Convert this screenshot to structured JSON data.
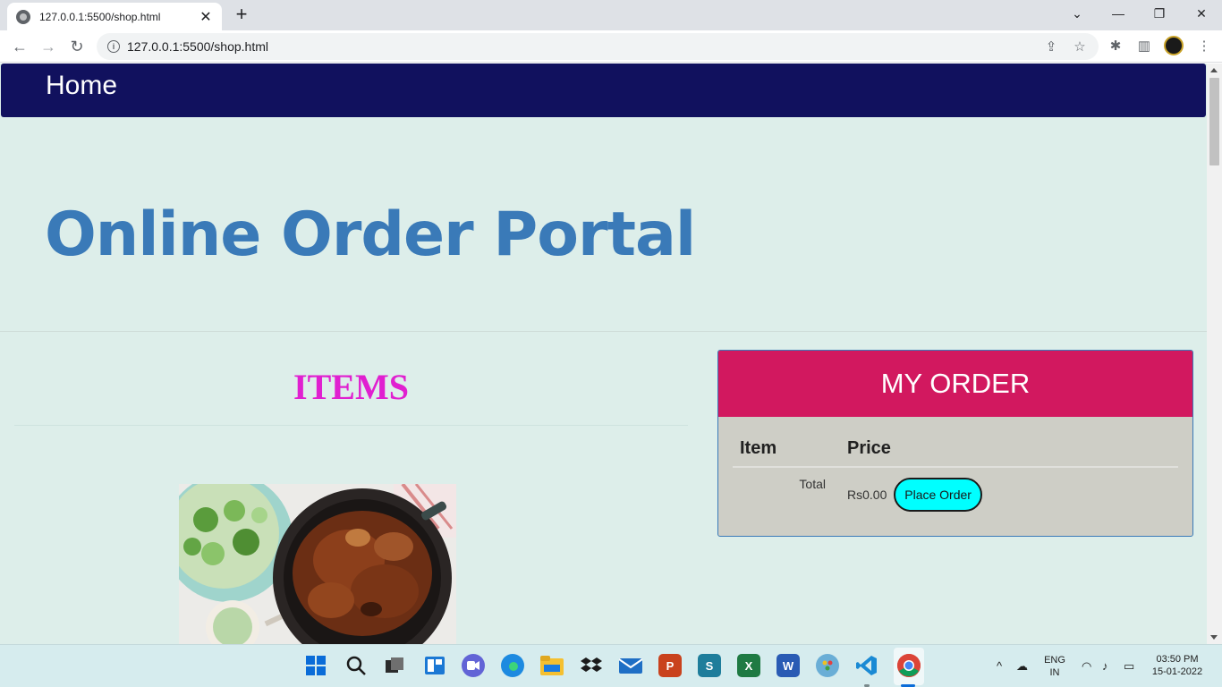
{
  "browser": {
    "tab_title": "127.0.0.1:5500/shop.html",
    "tab_close": "✕",
    "new_tab": "+",
    "url": "127.0.0.1:5500/shop.html",
    "win_controls": {
      "dropdown": "⌄",
      "minimize": "—",
      "restore": "❐",
      "close": "✕"
    },
    "nav": {
      "back": "←",
      "forward": "→",
      "reload": "↻"
    },
    "icons": {
      "share": "⇪",
      "star": "☆",
      "extensions": "✱",
      "sidepanel": "▥",
      "menu": "⋮"
    }
  },
  "site": {
    "nav_home": "Home",
    "hero_title": "Online Order Portal",
    "items_heading": "ITEMS",
    "order": {
      "title": "MY ORDER",
      "col_item": "Item",
      "col_price": "Price",
      "total_label": "Total",
      "total_value": "Rs0.00",
      "place_order": "Place Order"
    }
  },
  "taskbar": {
    "lang_top": "ENG",
    "lang_bottom": "IN",
    "time": "03:50 PM",
    "date": "15-01-2022",
    "tray_chevron": "^"
  },
  "colors": {
    "nav_bg": "#11115e",
    "page_bg": "#ddeeea",
    "hero": "#3a7ab8",
    "items": "#e020d0",
    "order_header": "#d2185f",
    "place_order_btn": "#00ffff"
  }
}
